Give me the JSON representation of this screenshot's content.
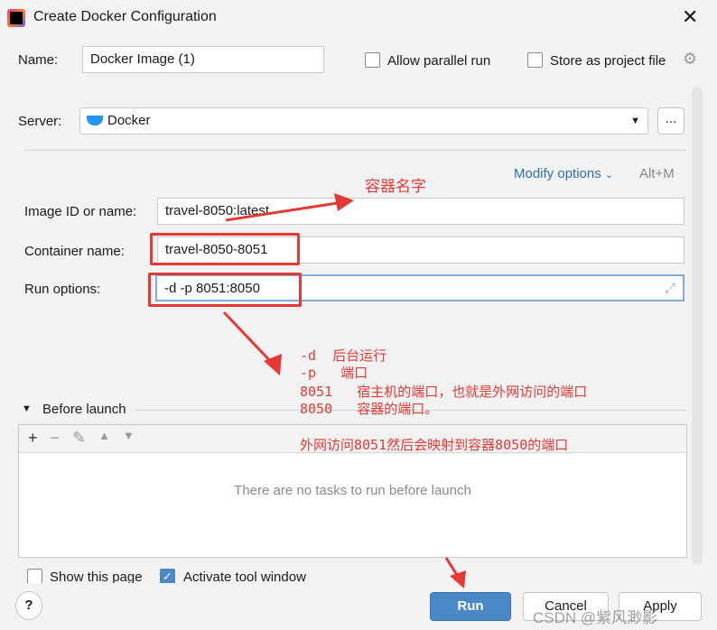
{
  "window": {
    "title": "Create Docker Configuration"
  },
  "name": {
    "label": "Name:",
    "value": "Docker Image (1)"
  },
  "allow_parallel": {
    "label": "Allow parallel run",
    "checked": false
  },
  "store_project": {
    "label": "Store as project file",
    "checked": false
  },
  "server": {
    "label": "Server:",
    "value": "Docker",
    "more": "..."
  },
  "modify": {
    "label": "Modify options",
    "shortcut": "Alt+M"
  },
  "image": {
    "label": "Image ID or name:",
    "value": "travel-8050:latest"
  },
  "container": {
    "label": "Container name:",
    "value": "travel-8050-8051"
  },
  "run_options": {
    "label": "Run options:",
    "value": "-d -p 8051:8050"
  },
  "before_launch": {
    "label": "Before launch",
    "empty": "There are no tasks to run before launch"
  },
  "show_page": {
    "label": "Show this page",
    "checked": false
  },
  "activate_tool": {
    "label": "Activate tool window",
    "checked": true
  },
  "buttons": {
    "run": "Run",
    "cancel": "Cancel",
    "apply": "Apply",
    "help": "?"
  },
  "annotations": {
    "image_note": "容器名字",
    "lines": [
      "-d  后台运行",
      "-p   端口",
      "8051   宿主机的端口，也就是外网访问的端口",
      "8050   容器的端口。"
    ],
    "summary": "外网访问8051然后会映射到容器8050的端口"
  },
  "watermark": "CSDN @紫风渺影",
  "colors": {
    "accent": "#4a88c7",
    "annotation": "#e53935",
    "link": "#2f6fb5"
  }
}
